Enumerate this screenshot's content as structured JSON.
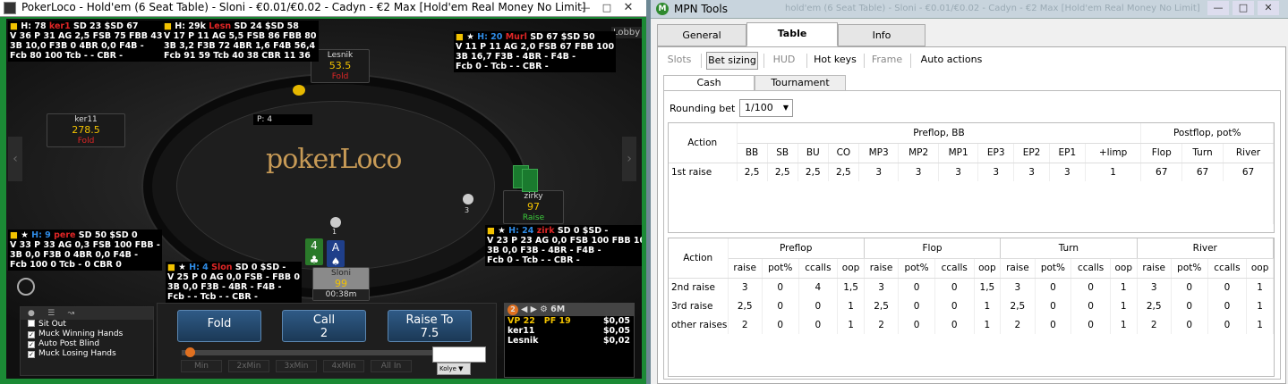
{
  "left_window": {
    "title": "PokerLoco - Hold'em (6 Seat Table) - Sloni - €0.01/€0.02 - Cadyn - €2 Max [Hold'em Real Money  No Limit]",
    "lobby": "Lobby"
  },
  "table": {
    "brand": "pokerLoco",
    "pot_label": "P: 4",
    "dealer_chip": "3",
    "dealer_chip_sloni": "1",
    "seats": [
      {
        "name": "Lesnik",
        "stack": "53.5",
        "status": "Fold"
      },
      {
        "name": "ker11",
        "stack": "278.5",
        "status": "Fold"
      },
      {
        "name": "zirky",
        "stack": "97",
        "status": "Raise"
      },
      {
        "name": "Sloni",
        "stack": "99",
        "timer": "00:38m"
      }
    ],
    "hero_cards": [
      "4",
      "A"
    ]
  },
  "huds": [
    {
      "l1a": "H: 78",
      "l1b": "ker1",
      "l1c": "SD 23 $SD 67",
      "l2": "V 36 P 31 AG 2,5 FSB 75 FBB 43",
      "l3": "3B 10,0 F3B 0 4BR 0,0 F4B -",
      "l4": "Fcb 80 100 Tcb - - CBR -"
    },
    {
      "l1a": "H: 29k",
      "l1b": "Lesn",
      "l1c": "SD 24 $SD 58",
      "l2": "V 17 P 11 AG 5,5 FSB 86 FBB 80",
      "l3": "3B 3,2 F3B 72 4BR 1,6 F4B 56,4",
      "l4": "Fcb 91 59 Tcb 40 38 CBR 11 36"
    },
    {
      "l1a": "H: 20",
      "l1b": "Murl",
      "l1c": "SD 67 $SD 50",
      "l2": "V 11 P 11 AG 2,0 FSB 67 FBB 100",
      "l3": "3B 16,7 F3B - 4BR - F4B -",
      "l4": "Fcb 0 - Tcb - - CBR -"
    },
    {
      "l1a": "H: 9",
      "l1b": "pere",
      "l1c": "SD 50 $SD 0",
      "l2": "V 33 P 33 AG 0,3 FSB 100 FBB -",
      "l3": "3B 0,0 F3B 0 4BR 0,0 F4B -",
      "l4": "Fcb 100 0 Tcb - 0 CBR 0"
    },
    {
      "l1a": "H: 24",
      "l1b": "zirk",
      "l1c": "SD 0 $SD -",
      "l2": "V 23 P 23 AG 0,0 FSB 100 FBB 100",
      "l3": "3B 0,0 F3B - 4BR - F4B -",
      "l4": "Fcb 0 - Tcb - - CBR -"
    },
    {
      "l1a": "H: 4",
      "l1b": "Slon",
      "l1c": "SD 0 $SD -",
      "l2": "V 25 P 0 AG 0,0 FSB - FBB 0",
      "l3": "3B 0,0 F3B - 4BR - F4B -",
      "l4": "Fcb - - Tcb - - CBR -"
    }
  ],
  "actions": {
    "fold": "Fold",
    "call": "Call",
    "call_amt": "2",
    "raise": "Raise To",
    "raise_amt": "7.5",
    "bet_input": "",
    "currency": "Kolye"
  },
  "presets": [
    "Min",
    "2xMin",
    "3xMin",
    "4xMin",
    "All In"
  ],
  "options": [
    "Sit Out",
    "Muck Winning Hands",
    "Auto Post Blind",
    "Muck Losing Hands"
  ],
  "mini": {
    "badge": "2",
    "level": "6M",
    "vp": "VP 22",
    "pf": "PF 19",
    "rows": [
      {
        "n": "",
        "v": "$0,05"
      },
      {
        "n": "ker11",
        "v": "$0,05"
      },
      {
        "n": "Lesnik",
        "v": "$0,02"
      }
    ]
  },
  "right_window": {
    "title": "MPN Tools",
    "ghost_title": "hold'em (6 Seat Table) - Sloni - €0.01/€0.02 - Cadyn - €2 Max [Hold'em Real Money  No Limit]"
  },
  "tabs": [
    "General",
    "Table",
    "Info"
  ],
  "subtabs": [
    "Slots",
    "Bet sizing",
    "HUD",
    "Hot keys",
    "Frame",
    "Auto actions"
  ],
  "mode_tabs": [
    "Cash",
    "Tournament"
  ],
  "rounding": {
    "label": "Rounding bet :",
    "value": "1/100"
  },
  "preflop_table": {
    "action": "Action",
    "group_preflop": "Preflop, BB",
    "group_postflop": "Postflop, pot%",
    "cols": [
      "BB",
      "SB",
      "BU",
      "CO",
      "MP3",
      "MP2",
      "MP1",
      "EP3",
      "EP2",
      "EP1",
      "+limp",
      "Flop",
      "Turn",
      "River"
    ],
    "row_label": "1st raise",
    "values": [
      "2,5",
      "2,5",
      "2,5",
      "2,5",
      "3",
      "3",
      "3",
      "3",
      "3",
      "3",
      "1",
      "67",
      "67",
      "67"
    ]
  },
  "street_table": {
    "action": "Action",
    "streets": [
      "Preflop",
      "Flop",
      "Turn",
      "River"
    ],
    "subcols": [
      "raise",
      "pot%",
      "ccalls",
      "oop"
    ],
    "rows": [
      {
        "label": "2nd raise",
        "v": [
          "3",
          "0",
          "4",
          "1,5",
          "3",
          "0",
          "0",
          "1,5",
          "3",
          "0",
          "0",
          "1",
          "3",
          "0",
          "0",
          "1"
        ]
      },
      {
        "label": "3rd raise",
        "v": [
          "2,5",
          "0",
          "0",
          "1",
          "2,5",
          "0",
          "0",
          "1",
          "2,5",
          "0",
          "0",
          "1",
          "2,5",
          "0",
          "0",
          "1"
        ]
      },
      {
        "label": "other raises",
        "v": [
          "2",
          "0",
          "0",
          "1",
          "2",
          "0",
          "0",
          "1",
          "2",
          "0",
          "0",
          "1",
          "2",
          "0",
          "0",
          "1"
        ]
      }
    ]
  }
}
